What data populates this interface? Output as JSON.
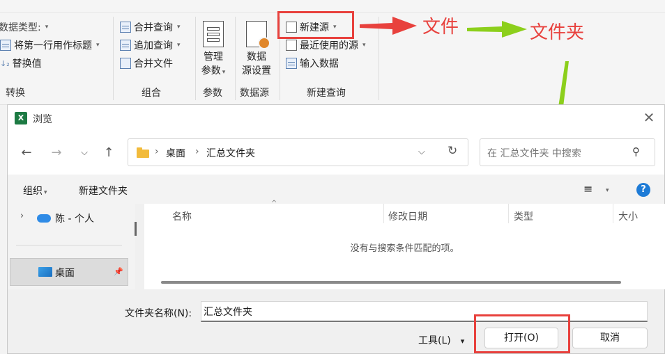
{
  "ribbon": {
    "transform": {
      "data_type": "数据类型:",
      "first_row_header": "将第一行用作标题",
      "replace_values": "替换值",
      "group_label": "转换"
    },
    "combine": {
      "merge_queries": "合并查询",
      "append_queries": "追加查询",
      "combine_files": "合并文件",
      "group_label": "组合"
    },
    "params": {
      "manage_line1": "管理",
      "manage_line2": "参数",
      "group_label": "参数"
    },
    "datasource": {
      "settings_line1": "数据",
      "settings_line2": "源设置",
      "group_label": "数据源"
    },
    "new_query": {
      "new_source": "新建源",
      "recent_sources": "最近使用的源",
      "enter_data": "输入数据",
      "group_label": "新建查询"
    }
  },
  "annotations": {
    "file": "文件",
    "folder": "文件夹"
  },
  "dialog": {
    "title": "浏览",
    "app_icon": "X",
    "close": "✕",
    "breadcrumb": [
      "桌面",
      "汇总文件夹"
    ],
    "search_placeholder": "在 汇总文件夹 中搜索",
    "organize": "组织",
    "new_folder": "新建文件夹",
    "help": "?",
    "nav": {
      "onedrive": "陈 - 个人",
      "desktop": "桌面"
    },
    "columns": [
      "名称",
      "修改日期",
      "类型",
      "大小"
    ],
    "empty_message": "没有与搜索条件匹配的项。",
    "folder_name_label": "文件夹名称(N):",
    "folder_name_value": "汇总文件夹",
    "tools": "工具(L)",
    "open": "打开(O)",
    "cancel": "取消"
  },
  "colors": {
    "annotation_red": "#e8413d",
    "annotation_green": "#8ccf1c",
    "excel_green": "#1d7a43",
    "help_blue": "#1e7bd6"
  }
}
